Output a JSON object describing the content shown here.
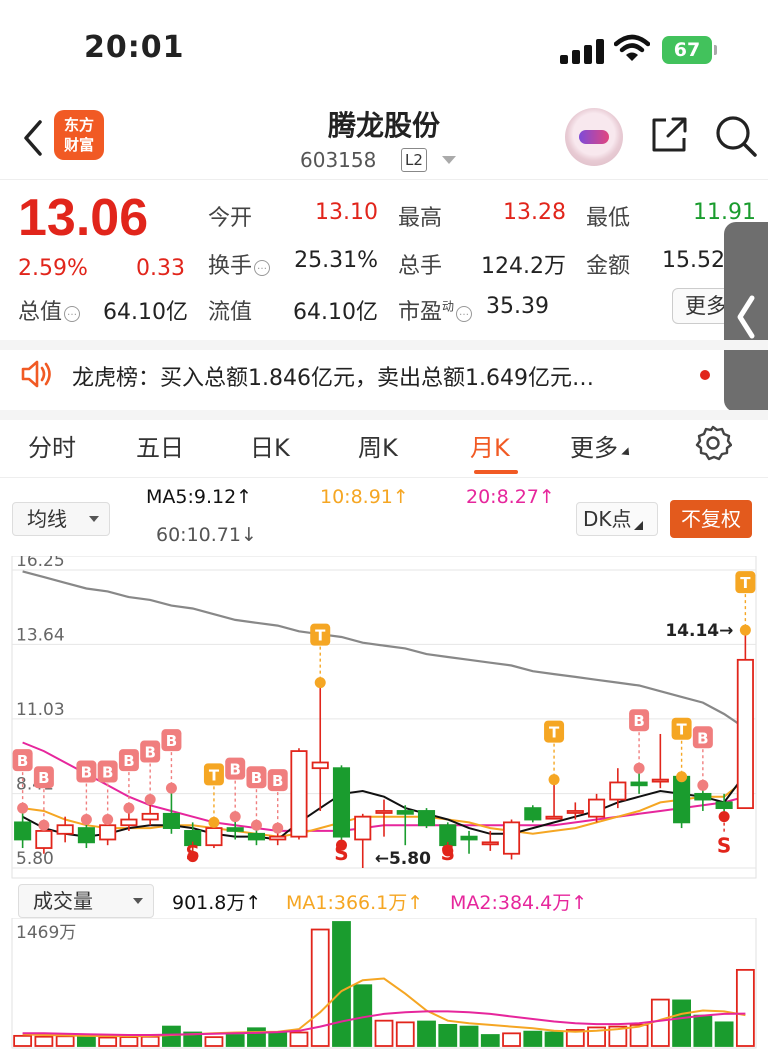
{
  "status": {
    "time": "20:01",
    "battery": "67"
  },
  "header": {
    "logo_line1": "东方",
    "logo_line2": "财富",
    "stock_name": "腾龙股份",
    "stock_code": "603158",
    "level_badge": "L2"
  },
  "quote": {
    "price": "13.06",
    "change_pct": "2.59%",
    "change": "0.33",
    "open_label": "今开",
    "open": "13.10",
    "high_label": "最高",
    "high": "13.28",
    "low_label": "最低",
    "low": "11.91",
    "turnover_label": "换手",
    "turnover": "25.31%",
    "hands_label": "总手",
    "hands": "124.2万",
    "amount_label": "金额",
    "amount": "15.52",
    "mcap_label": "总值",
    "mcap": "64.10亿",
    "float_label": "流值",
    "float_cap": "64.10亿",
    "pe_label": "市盈",
    "pe_sup": "动",
    "pe": "35.39",
    "more_label": "更多"
  },
  "ticker": {
    "text": "龙虎榜：买入总额1.846亿元，卖出总额1.649亿元…"
  },
  "tabs": [
    {
      "label": "分时"
    },
    {
      "label": "五日"
    },
    {
      "label": "日K"
    },
    {
      "label": "周K"
    },
    {
      "label": "月K"
    },
    {
      "label": "更多"
    }
  ],
  "kline_controls": {
    "indicator": "均线",
    "ma5": "MA5:9.12↑",
    "ma10": "10:8.91↑",
    "ma20": "20:8.27↑",
    "ma60": "60:10.71↓",
    "dk_label": "DK点",
    "adjust_label": "不复权"
  },
  "volume_controls": {
    "indicator": "成交量",
    "vol": "901.8万↑",
    "ma1": "MA1:366.1万↑",
    "ma2": "MA2:384.4万↑"
  },
  "colors": {
    "up": "#e1251b",
    "down": "#1a9c2e",
    "accent": "#f15a24",
    "ma5": "#111111",
    "ma10": "#f5a623",
    "ma20": "#e6269c",
    "ma60": "#888888"
  },
  "chart_data": [
    {
      "type": "candlestick",
      "title": "",
      "y_ticks": [
        16.25,
        13.64,
        11.03,
        8.41,
        5.8
      ],
      "ylim": [
        5.8,
        16.25
      ],
      "annotations": [
        {
          "text": "14.14→",
          "value": 14.14
        },
        {
          "text": "←5.80",
          "value": 5.8
        }
      ],
      "candles": [
        {
          "o": 7.4,
          "c": 6.8,
          "h": 7.9,
          "l": 6.5,
          "m": "B"
        },
        {
          "o": 6.5,
          "c": 7.1,
          "h": 7.3,
          "l": 6.3,
          "m": "B"
        },
        {
          "o": 7.0,
          "c": 7.3,
          "h": 7.6,
          "l": 6.7,
          "m": ""
        },
        {
          "o": 7.2,
          "c": 6.7,
          "h": 7.5,
          "l": 6.5,
          "m": "B"
        },
        {
          "o": 6.8,
          "c": 7.3,
          "h": 7.5,
          "l": 6.6,
          "m": "B"
        },
        {
          "o": 7.3,
          "c": 7.5,
          "h": 7.9,
          "l": 7.1,
          "m": "B"
        },
        {
          "o": 7.5,
          "c": 7.7,
          "h": 8.2,
          "l": 7.3,
          "m": "B"
        },
        {
          "o": 7.7,
          "c": 7.2,
          "h": 8.6,
          "l": 7.0,
          "m": "B"
        },
        {
          "o": 7.1,
          "c": 6.6,
          "h": 7.4,
          "l": 6.2,
          "m": "S"
        },
        {
          "o": 6.6,
          "c": 7.2,
          "h": 7.4,
          "l": 6.5,
          "m": "T"
        },
        {
          "o": 7.2,
          "c": 7.1,
          "h": 7.6,
          "l": 6.8,
          "m": "B"
        },
        {
          "o": 7.0,
          "c": 6.8,
          "h": 7.3,
          "l": 6.6,
          "m": "B"
        },
        {
          "o": 6.8,
          "c": 6.9,
          "h": 7.2,
          "l": 6.6,
          "m": "B"
        },
        {
          "o": 6.9,
          "c": 9.9,
          "h": 10.0,
          "l": 6.8,
          "m": ""
        },
        {
          "o": 9.3,
          "c": 9.5,
          "h": 12.3,
          "l": 7.8,
          "m": "T"
        },
        {
          "o": 9.3,
          "c": 6.9,
          "h": 9.4,
          "l": 6.6,
          "m": "S"
        },
        {
          "o": 6.8,
          "c": 7.6,
          "h": 7.7,
          "l": 5.8,
          "m": ""
        },
        {
          "o": 7.8,
          "c": 7.8,
          "h": 8.2,
          "l": 6.9,
          "m": ""
        },
        {
          "o": 7.8,
          "c": 7.7,
          "h": 8.0,
          "l": 6.6,
          "m": ""
        },
        {
          "o": 7.8,
          "c": 7.3,
          "h": 7.9,
          "l": 7.2,
          "m": ""
        },
        {
          "o": 7.3,
          "c": 6.6,
          "h": 7.4,
          "l": 6.4,
          "m": "S"
        },
        {
          "o": 6.9,
          "c": 6.8,
          "h": 7.1,
          "l": 6.3,
          "m": ""
        },
        {
          "o": 6.7,
          "c": 6.7,
          "h": 7.1,
          "l": 6.4,
          "m": ""
        },
        {
          "o": 6.3,
          "c": 7.4,
          "h": 7.5,
          "l": 6.1,
          "m": ""
        },
        {
          "o": 7.9,
          "c": 7.5,
          "h": 8.0,
          "l": 7.4,
          "m": ""
        },
        {
          "o": 7.6,
          "c": 7.6,
          "h": 8.9,
          "l": 7.5,
          "m": "T"
        },
        {
          "o": 7.8,
          "c": 7.8,
          "h": 8.1,
          "l": 7.5,
          "m": ""
        },
        {
          "o": 7.6,
          "c": 8.2,
          "h": 8.4,
          "l": 7.4,
          "m": ""
        },
        {
          "o": 8.2,
          "c": 8.8,
          "h": 9.3,
          "l": 7.9,
          "m": ""
        },
        {
          "o": 8.8,
          "c": 8.7,
          "h": 9.3,
          "l": 8.4,
          "m": "B"
        },
        {
          "o": 8.9,
          "c": 8.9,
          "h": 10.5,
          "l": 8.6,
          "m": ""
        },
        {
          "o": 9.0,
          "c": 7.4,
          "h": 9.0,
          "l": 7.2,
          "m": "T"
        },
        {
          "o": 8.4,
          "c": 8.2,
          "h": 8.7,
          "l": 7.8,
          "m": "B"
        },
        {
          "o": 8.1,
          "c": 7.9,
          "h": 8.4,
          "l": 7.6,
          "m": "S"
        },
        {
          "o": 7.9,
          "c": 13.1,
          "h": 14.14,
          "l": 7.9,
          "m": "T"
        }
      ],
      "ma5": [
        7.6,
        7.2,
        7.0,
        6.9,
        7.0,
        7.2,
        7.3,
        7.3,
        7.2,
        7.0,
        6.9,
        6.9,
        6.8,
        7.4,
        7.9,
        8.4,
        8.5,
        8.3,
        7.9,
        7.7,
        7.5,
        7.2,
        7.0,
        7.0,
        7.2,
        7.4,
        7.6,
        7.8,
        8.1,
        8.3,
        8.5,
        8.4,
        8.3,
        8.1,
        9.1
      ],
      "ma10": [
        7.9,
        7.8,
        7.5,
        7.3,
        7.2,
        7.2,
        7.2,
        7.3,
        7.3,
        7.2,
        7.1,
        7.0,
        6.9,
        7.0,
        7.2,
        7.4,
        7.6,
        7.6,
        7.6,
        7.6,
        7.5,
        7.4,
        7.2,
        7.1,
        7.0,
        7.1,
        7.2,
        7.4,
        7.6,
        7.8,
        8.1,
        8.2,
        8.3,
        8.3,
        8.9
      ],
      "ma20": [
        10.2,
        9.9,
        9.5,
        9.1,
        8.7,
        8.3,
        8.0,
        7.8,
        7.6,
        7.4,
        7.3,
        7.2,
        7.1,
        7.1,
        7.1,
        7.1,
        7.2,
        7.3,
        7.3,
        7.3,
        7.3,
        7.3,
        7.3,
        7.3,
        7.3,
        7.3,
        7.4,
        7.5,
        7.6,
        7.7,
        7.8,
        7.9,
        8.0,
        8.1,
        8.3
      ],
      "ma60": [
        16.2,
        16.0,
        15.8,
        15.6,
        15.5,
        15.3,
        15.2,
        15.0,
        14.9,
        14.7,
        14.5,
        14.4,
        14.3,
        14.1,
        14.0,
        13.9,
        13.7,
        13.6,
        13.5,
        13.3,
        13.2,
        13.1,
        13.0,
        12.9,
        12.7,
        12.6,
        12.5,
        12.4,
        12.3,
        12.2,
        12.0,
        11.8,
        11.6,
        11.2,
        10.7
      ]
    },
    {
      "type": "bar",
      "title": "",
      "y_ticks": [
        1469
      ],
      "y_tick_label": "1469万",
      "ylim": [
        0,
        1469
      ],
      "values": [
        120,
        110,
        115,
        120,
        100,
        105,
        110,
        230,
        160,
        105,
        130,
        210,
        150,
        160,
        1380,
        1469,
        720,
        300,
        280,
        290,
        250,
        230,
        130,
        150,
        170,
        160,
        190,
        220,
        230,
        250,
        550,
        540,
        360,
        280,
        901.8
      ],
      "up": [
        true,
        true,
        true,
        false,
        true,
        true,
        true,
        false,
        false,
        true,
        false,
        false,
        false,
        true,
        true,
        false,
        false,
        true,
        true,
        false,
        false,
        false,
        false,
        true,
        false,
        false,
        true,
        true,
        true,
        true,
        true,
        false,
        false,
        false,
        true
      ],
      "ma1": [
        140,
        130,
        125,
        120,
        118,
        115,
        118,
        130,
        140,
        150,
        160,
        165,
        170,
        200,
        400,
        650,
        780,
        800,
        620,
        420,
        300,
        270,
        250,
        230,
        210,
        180,
        170,
        180,
        200,
        230,
        310,
        380,
        420,
        410,
        366.1
      ],
      "ma2": [
        150,
        150,
        145,
        140,
        135,
        130,
        130,
        135,
        140,
        145,
        150,
        155,
        165,
        180,
        230,
        290,
        340,
        380,
        400,
        410,
        410,
        400,
        380,
        350,
        320,
        290,
        270,
        260,
        260,
        270,
        300,
        330,
        360,
        380,
        384.4
      ]
    }
  ]
}
